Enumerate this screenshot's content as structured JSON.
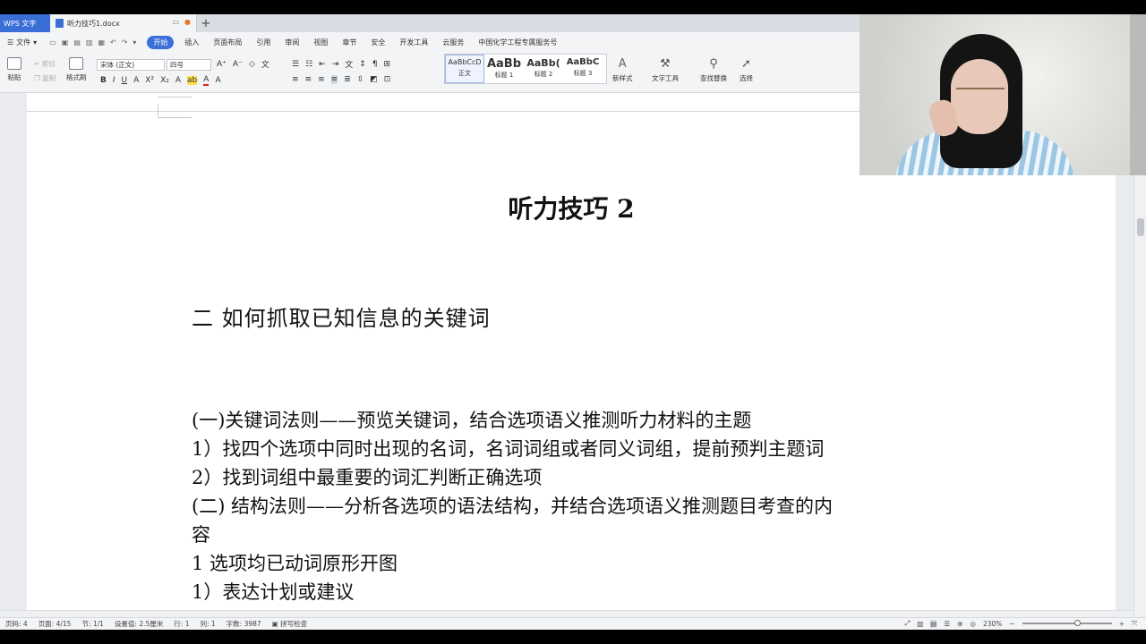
{
  "tabs": {
    "app": "WPS 文字",
    "document": "听力技巧1.docx"
  },
  "menu": {
    "file": "文件",
    "items": [
      "开始",
      "插入",
      "页面布局",
      "引用",
      "审阅",
      "视图",
      "章节",
      "安全",
      "开发工具",
      "云服务",
      "中国化学工程专属服务号"
    ],
    "active_index": 0
  },
  "ribbon": {
    "paste": "粘贴",
    "cut": "剪切",
    "copy": "复制",
    "format_painter": "格式刷",
    "font_name": "宋体 (正文)",
    "font_size": "四号",
    "styles": [
      {
        "sample": "AaBbCcD",
        "label": "正文"
      },
      {
        "sample": "AaBb",
        "label": "标题 1"
      },
      {
        "sample": "AaBb(",
        "label": "标题 2"
      },
      {
        "sample": "AaBbC",
        "label": "标题 3"
      }
    ],
    "new_style": "新样式",
    "text_tools": "文字工具",
    "find_replace": "查找替换",
    "select": "选择"
  },
  "document": {
    "title": "听力技巧 2",
    "heading": "二  如何抓取已知信息的关键词",
    "lines": [
      "(一)关键词法则——预览关键词，结合选项语义推测听力材料的主题",
      "1）找四个选项中同时出现的名词，名词词组或者同义词组，提前预判主题词",
      "2）找到词组中最重要的词汇判断正确选项",
      "(二)  结构法则——分析各选项的语法结构，并结合选项语义推测题目考查的内",
      "容",
      "1  选项均已动词原形开图",
      "1）表达计划或建议"
    ]
  },
  "status": {
    "page_num": "页码: 4",
    "pages": "页面: 4/15",
    "section": "节: 1/1",
    "setting": "设置值: 2.5厘米",
    "row": "行: 1",
    "col": "列: 1",
    "word_count": "字数: 3987",
    "spell_check": "拼写检查",
    "zoom": "230%"
  }
}
